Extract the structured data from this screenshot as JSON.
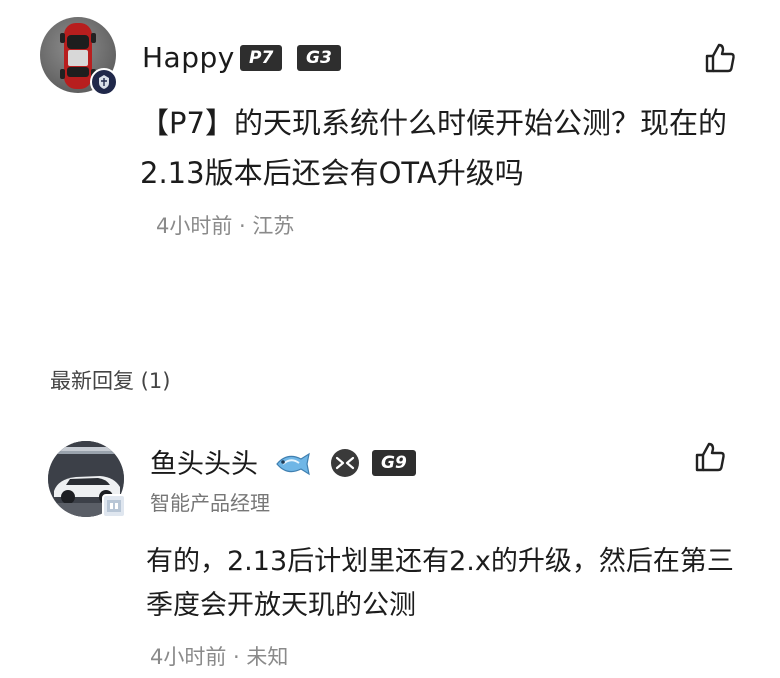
{
  "main_comment": {
    "username": "Happy",
    "badges": [
      "P7",
      "G3"
    ],
    "text": "【P7】的天玑系统什么时候开始公测？现在的2.13版本后还会有OTA升级吗",
    "time": "4小时前",
    "location": "江苏",
    "meta": "4小时前 · 江苏",
    "icons": {
      "avatar": "red-car-avatar",
      "avatar_badge": "crest-badge-icon",
      "like": "thumbs-up-icon"
    }
  },
  "replies_header": "最新回复 (1)",
  "reply": {
    "username": "鱼头头头",
    "username_icon": "fish-icon",
    "brand_icon": "xpeng-logo-icon",
    "badge": "G9",
    "role": "智能产品经理",
    "text": "有的，2.13后计划里还有2.x的升级，然后在第三季度会开放天玑的公测",
    "time": "4小时前",
    "location": "未知",
    "meta": "4小时前 · 未知",
    "icons": {
      "avatar": "white-car-avatar",
      "like": "thumbs-up-icon"
    }
  },
  "colors": {
    "text": "#1c1c1c",
    "muted": "#8a8a8a",
    "tag_bg": "#2e2e2e",
    "tag_fg": "#ffffff"
  }
}
